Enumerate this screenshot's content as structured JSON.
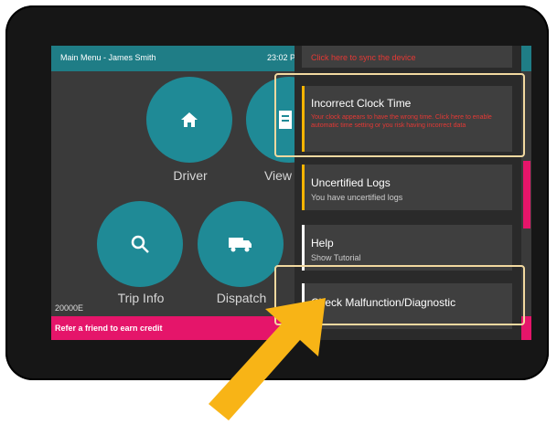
{
  "header": {
    "title": "Main Menu - James Smith",
    "clock": "23:02 P"
  },
  "main_menu": {
    "driver_label": "Driver",
    "view_label": "View",
    "trip_info_label": "Trip Info",
    "dispatch_label": "Dispatch",
    "unit_number": "20000E"
  },
  "promo": {
    "text": "Refer a friend to earn credit"
  },
  "notifications": {
    "clipped_top_text": "Click here to sync the device",
    "items": [
      {
        "title": "Incorrect Clock Time",
        "subtitle": "Your clock appears to have the wrong time. Click here to enable automatic time setting or you risk having incorrect data",
        "accent": "#f5b400",
        "subtitle_color": "#e53935"
      },
      {
        "title": "Uncertified Logs",
        "subtitle": "You have uncertified logs",
        "accent": "#f5b400",
        "subtitle_color": "#cccccc"
      },
      {
        "title": "Help",
        "subtitle": "Show Tutorial",
        "accent": "#ffffff",
        "subtitle_color": "#cccccc"
      },
      {
        "title": "Check Malfunction/Diagnostic",
        "subtitle": "",
        "accent": "#ffffff",
        "subtitle_color": "#cccccc"
      }
    ]
  },
  "colors": {
    "teal": "#1f8a96",
    "pink": "#e5156a",
    "arrow": "#f8b416"
  }
}
